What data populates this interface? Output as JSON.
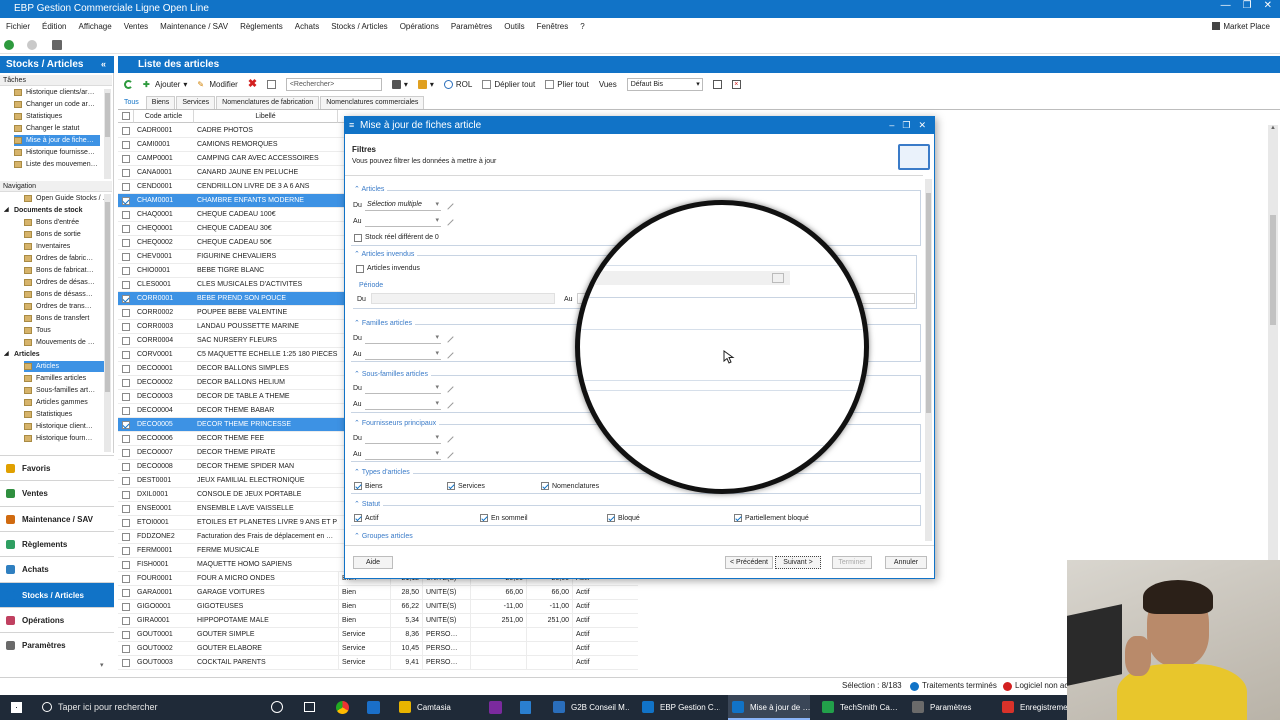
{
  "window": {
    "title": "EBP Gestion Commerciale Ligne Open Line",
    "controls": [
      "—",
      "❐",
      "✕"
    ]
  },
  "menu": [
    "Fichier",
    "Édition",
    "Affichage",
    "Ventes",
    "Maintenance / SAV",
    "Règlements",
    "Achats",
    "Stocks / Articles",
    "Opérations",
    "Paramètres",
    "Outils",
    "Fenêtres",
    "?"
  ],
  "market_place": "Market Place",
  "left_pane": {
    "title": "Stocks / Articles",
    "taches_label": "Tâches",
    "taches": [
      "Historique clients/ar…",
      "Changer un code ar…",
      "Statistiques",
      "Changer le statut",
      "Mise à jour de fiche…",
      "Historique fournisse…",
      "Liste des mouvemen…"
    ],
    "navigation_label": "Navigation",
    "nav_items": [
      {
        "label": "Open Guide Stocks / …",
        "type": "item"
      },
      {
        "label": "Documents de stock",
        "type": "group"
      },
      {
        "label": "Bons d'entrée",
        "type": "item"
      },
      {
        "label": "Bons de sortie",
        "type": "item"
      },
      {
        "label": "Inventaires",
        "type": "item"
      },
      {
        "label": "Ordres de fabric…",
        "type": "item"
      },
      {
        "label": "Bons de fabricat…",
        "type": "item"
      },
      {
        "label": "Ordres de désas…",
        "type": "item"
      },
      {
        "label": "Bons de désass…",
        "type": "item"
      },
      {
        "label": "Ordres de trans…",
        "type": "item"
      },
      {
        "label": "Bons de transfert",
        "type": "item"
      },
      {
        "label": "Tous",
        "type": "item"
      },
      {
        "label": "Mouvements de …",
        "type": "item"
      },
      {
        "label": "Articles",
        "type": "group"
      },
      {
        "label": "Articles",
        "type": "selected"
      },
      {
        "label": "Familles articles",
        "type": "item"
      },
      {
        "label": "Sous-familles art…",
        "type": "item"
      },
      {
        "label": "Articles gammes",
        "type": "item"
      },
      {
        "label": "Statistiques",
        "type": "item"
      },
      {
        "label": "Historique client…",
        "type": "item"
      },
      {
        "label": "Historique fourn…",
        "type": "item"
      }
    ],
    "modules": [
      "Favoris",
      "Ventes",
      "Maintenance / SAV",
      "Règlements",
      "Achats",
      "Stocks / Articles",
      "Opérations",
      "Paramètres"
    ],
    "modules_selected": "Stocks / Articles",
    "module_colors": [
      "#e0a000",
      "#2f8f3f",
      "#d06a10",
      "#2f9f62",
      "#2f7fc0",
      "#1173c7",
      "#c04060",
      "#6a6a6a"
    ]
  },
  "main": {
    "title": "Liste des articles",
    "toolbar": {
      "ajouter": "Ajouter",
      "modifier": "Modifier",
      "search_placeholder": "<Rechercher>",
      "rol": "ROL",
      "deplier": "Déplier tout",
      "plier": "Plier tout",
      "vues": "Vues",
      "vue_value": "Défaut Bis"
    },
    "tabs": [
      "Tous",
      "Biens",
      "Services",
      "Nomenclatures de fabrication",
      "Nomenclatures commerciales"
    ],
    "columns": [
      "Code article",
      "Libellé"
    ],
    "rows": [
      {
        "code": "CADR0001",
        "label": "CADRE PHOTOS",
        "sel": false
      },
      {
        "code": "CAMI0001",
        "label": "CAMIONS REMORQUES",
        "sel": false
      },
      {
        "code": "CAMP0001",
        "label": "CAMPING CAR AVEC ACCESSOIRES",
        "sel": false
      },
      {
        "code": "CANA0001",
        "label": "CANARD JAUNE EN PELUCHE",
        "sel": false
      },
      {
        "code": "CEND0001",
        "label": "CENDRILLON LIVRE DE 3 A 6 ANS",
        "sel": false
      },
      {
        "code": "CHAM0001",
        "label": "CHAMBRE ENFANTS MODERNE",
        "sel": true
      },
      {
        "code": "CHAQ0001",
        "label": "CHEQUE CADEAU 100€",
        "sel": false
      },
      {
        "code": "CHEQ0001",
        "label": "CHEQUE CADEAU 30€",
        "sel": false
      },
      {
        "code": "CHEQ0002",
        "label": "CHEQUE CADEAU 50€",
        "sel": false
      },
      {
        "code": "CHEV0001",
        "label": "FIGURINE CHEVALIERS",
        "sel": false
      },
      {
        "code": "CHIO0001",
        "label": "BEBE TIGRE BLANC",
        "sel": false
      },
      {
        "code": "CLES0001",
        "label": "CLES MUSICALES D'ACTIVITES",
        "sel": false
      },
      {
        "code": "CORR0001",
        "label": "BEBE PREND SON POUCE",
        "sel": true
      },
      {
        "code": "CORR0002",
        "label": "POUPEE BEBE VALENTINE",
        "sel": false
      },
      {
        "code": "CORR0003",
        "label": "LANDAU POUSSETTE MARINE",
        "sel": false
      },
      {
        "code": "CORR0004",
        "label": "SAC NURSERY FLEURS",
        "sel": false
      },
      {
        "code": "CORV0001",
        "label": "C5 MAQUETTE ECHELLE 1:25 180 PIECES",
        "sel": false
      },
      {
        "code": "DECO0001",
        "label": "DECOR BALLONS SIMPLES",
        "sel": false
      },
      {
        "code": "DECO0002",
        "label": "DECOR BALLONS HELIUM",
        "sel": false
      },
      {
        "code": "DECO0003",
        "label": "DECOR DE TABLE A THEME",
        "sel": false
      },
      {
        "code": "DECO0004",
        "label": "DECOR THEME BABAR",
        "sel": false
      },
      {
        "code": "DECO0005",
        "label": "DECOR THEME PRINCESSE",
        "sel": true
      },
      {
        "code": "DECO0006",
        "label": "DECOR THEME FEE",
        "sel": false
      },
      {
        "code": "DECO0007",
        "label": "DECOR THEME PIRATE",
        "sel": false
      },
      {
        "code": "DECO0008",
        "label": "DECOR THEME SPIDER MAN",
        "sel": false
      },
      {
        "code": "DEST0001",
        "label": "JEUX FAMILIAL ELECTRONIQUE",
        "sel": false
      },
      {
        "code": "DXIL0001",
        "label": "CONSOLE DE JEUX PORTABLE",
        "sel": false
      },
      {
        "code": "ENSE0001",
        "label": "ENSEMBLE LAVE VAISSELLE",
        "sel": false
      },
      {
        "code": "ETOI0001",
        "label": "ETOILES ET PLANETES LIVRE 9 ANS ET P…",
        "sel": false
      },
      {
        "code": "FDDZONE2",
        "label": "Facturation des Frais de déplacement en …",
        "sel": false
      },
      {
        "code": "FERM0001",
        "label": "FERME MUSICALE",
        "sel": false
      },
      {
        "code": "FISH0001",
        "label": "MAQUETTE HOMO SAPIENS",
        "sel": false
      },
      {
        "code": "FOUR0001",
        "label": "FOUR A MICRO ONDES",
        "sel": false,
        "type": "Bien",
        "price": "21,12",
        "unit": "UNITE(S)",
        "stock": "20,00",
        "stock2": "20,00",
        "status": "Actif"
      },
      {
        "code": "GARA0001",
        "label": "GARAGE VOITURES",
        "sel": false,
        "type": "Bien",
        "price": "28,50",
        "unit": "UNITE(S)",
        "stock": "66,00",
        "stock2": "66,00",
        "status": "Actif"
      },
      {
        "code": "GIGO0001",
        "label": "GIGOTEUSES",
        "sel": false,
        "type": "Bien",
        "price": "66,22",
        "unit": "UNITE(S)",
        "stock": "-11,00",
        "stock2": "-11,00",
        "status": "Actif"
      },
      {
        "code": "GIRA0001",
        "label": "HIPPOPOTAME MALE",
        "sel": false,
        "type": "Bien",
        "price": "5,34",
        "unit": "UNITE(S)",
        "stock": "251,00",
        "stock2": "251,00",
        "status": "Actif"
      },
      {
        "code": "GOUT0001",
        "label": "GOUTER SIMPLE",
        "sel": false,
        "type": "Service",
        "price": "8,36",
        "unit": "PERSO…",
        "stock": "",
        "stock2": "",
        "status": "Actif"
      },
      {
        "code": "GOUT0002",
        "label": "GOUTER ELABORE",
        "sel": false,
        "type": "Service",
        "price": "10,45",
        "unit": "PERSO…",
        "stock": "",
        "stock2": "",
        "status": "Actif"
      },
      {
        "code": "GOUT0003",
        "label": "COCKTAIL PARENTS",
        "sel": false,
        "type": "Service",
        "price": "9,41",
        "unit": "PERSO…",
        "stock": "",
        "stock2": "",
        "status": "Actif"
      }
    ]
  },
  "dialog": {
    "title": "Mise à jour de fiches article",
    "heading": "Filtres",
    "subtitle": "Vous pouvez filtrer les données à mettre à jour",
    "du": "Du",
    "au": "Au",
    "articles_legend": "Articles",
    "articles_du_value": "Sélection multiple",
    "stock_reel": "Stock réel différent de 0",
    "invendus_legend": "Articles invendus",
    "invendus_check": "Articles invendus",
    "periode": "Période",
    "familles_legend": "Familles articles",
    "sousfamilles_legend": "Sous-familles articles",
    "fournisseurs_legend": "Fournisseurs principaux",
    "types_legend": "Types d'articles",
    "types": [
      "Biens",
      "Services",
      "Nomenclatures"
    ],
    "statut_legend": "Statut",
    "statuts": [
      "Actif",
      "En sommeil",
      "Bloqué",
      "Partiellement bloqué"
    ],
    "groupes_legend": "Groupes articles",
    "buttons": {
      "aide": "Aide",
      "precedent": "< Précédent",
      "suivant": "Suivant >",
      "terminer": "Terminer",
      "annuler": "Annuler"
    }
  },
  "statusbar": {
    "selection": "Sélection : 8/183",
    "traitements": "Traitements terminés",
    "logiciel": "Logiciel non ac"
  },
  "taskbar": {
    "search": "Taper ici pour rechercher",
    "apps": [
      {
        "label": "Camtasia",
        "color": "#e8b400"
      },
      {
        "label": "G2B Conseil M…",
        "color": "#2a6ebb"
      },
      {
        "label": "EBP Gestion C…",
        "color": "#1173c7"
      },
      {
        "label": "Mise à jour de …",
        "color": "#1173c7"
      },
      {
        "label": "TechSmith Ca…",
        "color": "#22a04a"
      },
      {
        "label": "Paramètres",
        "color": "#6a6a6a"
      },
      {
        "label": "Enregistreme…",
        "color": "#d8322a"
      }
    ]
  }
}
